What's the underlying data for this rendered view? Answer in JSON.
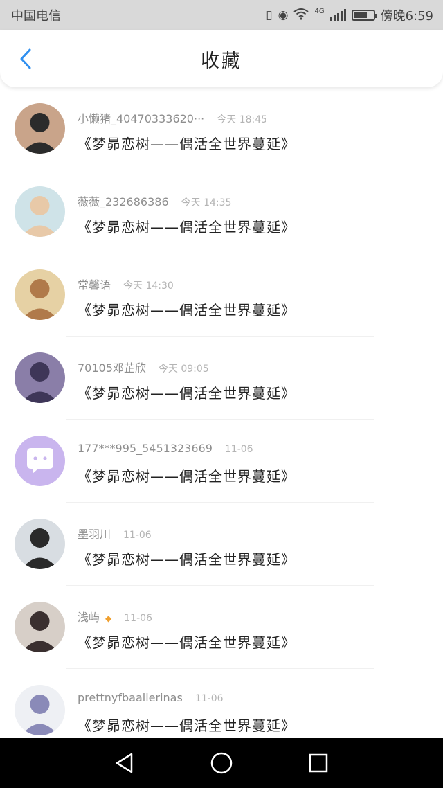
{
  "status_bar": {
    "carrier": "中国电信",
    "network": "4G",
    "time": "傍晚6:59"
  },
  "header": {
    "title": "收藏"
  },
  "items": [
    {
      "name": "小懒猪_40470333620···",
      "time": "今天 18:45",
      "content": "《梦昴恋树——偶活全世界蔓延》",
      "avatar": {
        "bg": "#c9a48a",
        "fg": "#2b2b2b"
      }
    },
    {
      "name": "薇薇_232686386",
      "time": "今天 14:35",
      "content": "《梦昴恋树——偶活全世界蔓延》",
      "avatar": {
        "bg": "#cfe3e8",
        "fg": "#e8c9a8"
      }
    },
    {
      "name": "常馨语",
      "time": "今天 14:30",
      "content": "《梦昴恋树——偶活全世界蔓延》",
      "avatar": {
        "bg": "#e6d1a4",
        "fg": "#b07a4a"
      }
    },
    {
      "name": "70105邓芷欣",
      "time": "今天 09:05",
      "content": "《梦昴恋树——偶活全世界蔓延》",
      "avatar": {
        "bg": "#8a7ea8",
        "fg": "#3e3658"
      }
    },
    {
      "name": "177***995_5451323669",
      "time": "11-06",
      "content": "《梦昴恋树——偶活全世界蔓延》",
      "avatar": {
        "bg": "#c9b5ee",
        "fg": "#ffffff"
      }
    },
    {
      "name": "墨羽川",
      "time": "11-06",
      "content": "《梦昴恋树——偶活全世界蔓延》",
      "avatar": {
        "bg": "#d8dde2",
        "fg": "#2a2a2a"
      }
    },
    {
      "name": "浅屿",
      "time": "11-06",
      "badge": "◆",
      "content": "《梦昴恋树——偶活全世界蔓延》",
      "avatar": {
        "bg": "#d7cfc8",
        "fg": "#3a2f2f"
      }
    },
    {
      "name": "prettnyfbaallerinas",
      "time": "11-06",
      "content": "《梦昴恋树——偶活全世界蔓延》",
      "avatar": {
        "bg": "#eef0f4",
        "fg": "#8a8ab8"
      }
    }
  ],
  "nav": {
    "back": "back-triangle",
    "home": "home-circle",
    "recent": "recent-square"
  }
}
